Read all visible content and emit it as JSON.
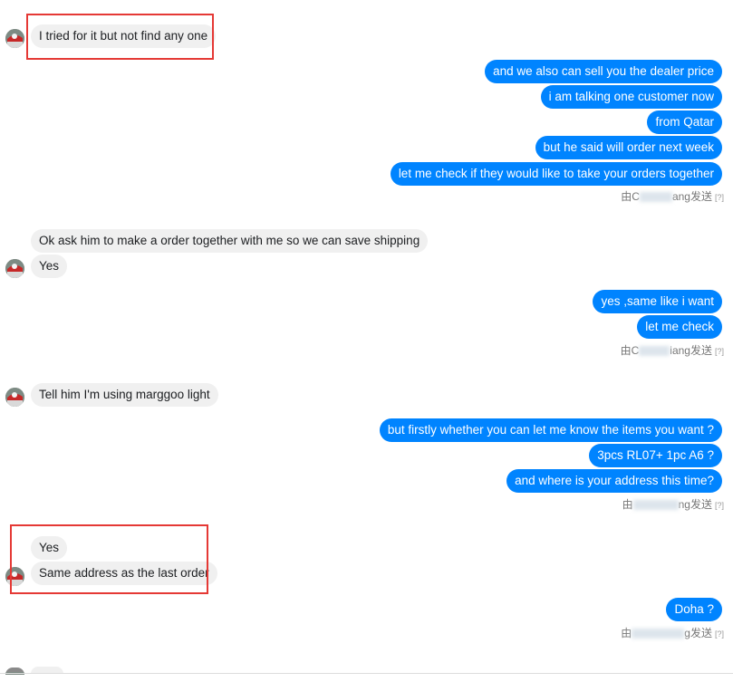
{
  "messages": {
    "m1": "I tried for it but not find any one",
    "m2": "and we also can sell you the dealer  price",
    "m3": "i am talking one customer now",
    "m4": "from Qatar",
    "m5": "but he said will order next week",
    "m6": "let me check if they would like to take your orders together",
    "m7": "Ok ask him to make a order together with me so we can save shipping",
    "m8": "Yes",
    "m9": "yes ,same like i want",
    "m10": "let me check",
    "m11": "Tell him I'm using marggoo light",
    "m12": "but firstly whether you can let me know the items you want ?",
    "m13": "3pcs RL07+ 1pc A6 ?",
    "m14": "and where is your address this time?",
    "m15": "Yes",
    "m16": "Same address as the last order",
    "m17": "Doha ?"
  },
  "sent_by": {
    "s1": {
      "prefix": "由C",
      "suffix": "ang发送",
      "help": "[?]"
    },
    "s2": {
      "prefix": "由C",
      "suffix": "iang发送",
      "help": "[?]"
    },
    "s3": {
      "prefix": "由",
      "suffix": "ng发送",
      "help": "[?]"
    },
    "s4": {
      "prefix": "由",
      "suffix": "g发送",
      "help": "[?]"
    }
  },
  "colors": {
    "outgoing": "#0084ff",
    "incoming": "#f0f0f0",
    "highlight": "#e53935"
  }
}
